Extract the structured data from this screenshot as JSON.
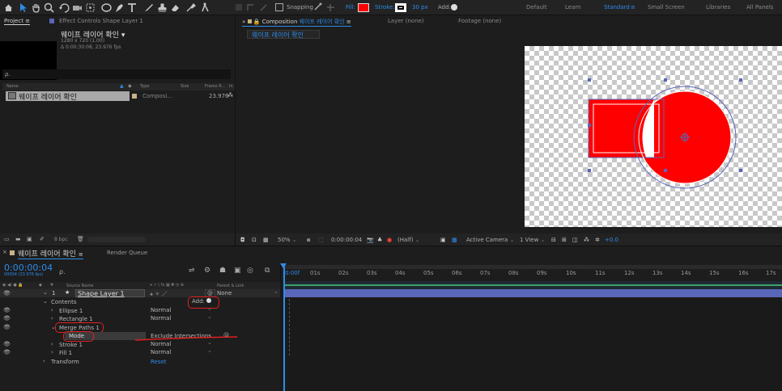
{
  "toolbar": {
    "snapping_label": "Snapping",
    "fill_label": "Fill:",
    "stroke_label": "Stroke:",
    "stroke_width": "30 px",
    "add_label": "Add:",
    "workspaces": [
      "Default",
      "Learn",
      "Standard",
      "Small Screen",
      "Libraries",
      "All Panels"
    ],
    "active_workspace": "Standard",
    "fill_color": "#ff0000"
  },
  "project": {
    "tab_label": "Project",
    "effect_controls_label": "Effect Controls Shape Layer 1",
    "comp_name": "웨이프 레이어 확인",
    "comp_size": "1280 x 720 (1.00)",
    "comp_duration": "Δ 0:00:30:08, 23.976 fps",
    "search_placeholder": "ρ.",
    "col_name": "Name",
    "col_type": "Type",
    "col_size": "Size",
    "col_frame": "Frame R...",
    "col_in": "In",
    "item_name": "웨이프 레이어 확인",
    "item_type": "Composi...",
    "item_fps": "23.976",
    "bpc": "8 bpc"
  },
  "composition": {
    "tab_prefix": "Composition",
    "tab_name": "웨이프 레이어 확인",
    "layer_tab": "Layer (none)",
    "footage_tab": "Footage (none)",
    "breadcrumb": "웨이프 레이어 확인",
    "zoom": "50%",
    "timecode": "0:00:00:04",
    "resolution": "(Half)",
    "camera": "Active Camera",
    "view": "1 View",
    "exposure": "+0.0"
  },
  "timeline": {
    "tab_name": "웨이프 레이어 확인",
    "render_queue": "Render Queue",
    "current_time": "0:00:00:04",
    "frame_info": "00004 (23.976 fps)",
    "search_placeholder": "ρ.",
    "col_source": "Source Name",
    "col_parent": "Parent & Link",
    "layer_num": "1",
    "layer_name": "Shape Layer 1",
    "parent_value": "None",
    "contents_label": "Contents",
    "add_label": "Add:",
    "ellipse": "Ellipse 1",
    "ellipse_mode": "Normal",
    "rectangle": "Rectangle 1",
    "rectangle_mode": "Normal",
    "merge_paths": "Merge Paths 1",
    "mode_label": "Mode",
    "mode_value": "Exclude Intersections",
    "stroke": "Stroke 1",
    "stroke_mode": "Normal",
    "fill": "Fill 1",
    "fill_mode": "Normal",
    "transform": "Transform",
    "reset": "Reset",
    "ruler": [
      "0:00f",
      "01s",
      "02s",
      "03s",
      "04s",
      "05s",
      "06s",
      "07s",
      "08s",
      "09s",
      "10s",
      "11s",
      "12s",
      "13s",
      "14s",
      "15s",
      "16s",
      "17s"
    ],
    "layer_bar_color": "#5a66b8",
    "annotation_color": "#e02020"
  }
}
